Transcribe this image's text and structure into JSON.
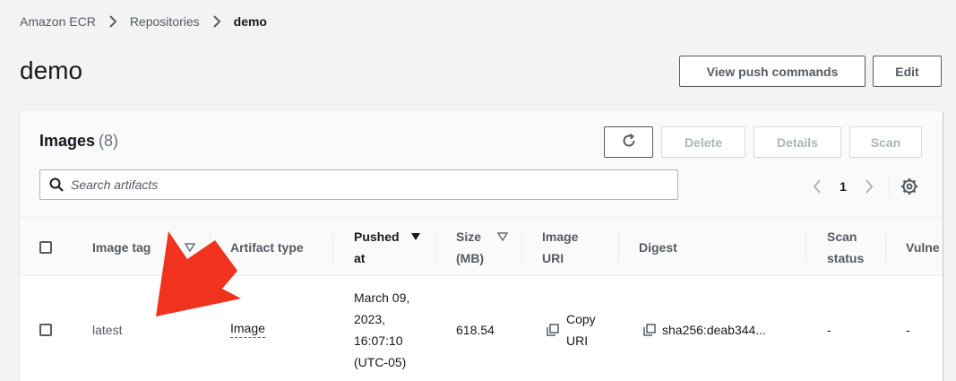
{
  "breadcrumb": {
    "root": "Amazon ECR",
    "section": "Repositories",
    "current": "demo"
  },
  "page": {
    "title": "demo",
    "view_push_label": "View push commands",
    "edit_label": "Edit"
  },
  "images_panel": {
    "title": "Images",
    "count": "(8)",
    "delete_label": "Delete",
    "details_label": "Details",
    "scan_label": "Scan",
    "search_placeholder": "Search artifacts",
    "page_number": "1"
  },
  "table": {
    "columns": {
      "image_tag": "Image tag",
      "artifact_type": "Artifact type",
      "pushed_at_1": "Pushed",
      "pushed_at_2": "at",
      "size_1": "Size",
      "size_2": "(MB)",
      "uri_1": "Image",
      "uri_2": "URI",
      "digest": "Digest",
      "scan_1": "Scan",
      "scan_2": "status",
      "vuln": "Vulne"
    },
    "rows": [
      {
        "tag": "latest",
        "artifact_type": "Image",
        "pushed_1": "March 09,",
        "pushed_2": "2023,",
        "pushed_3": "16:07:10",
        "pushed_4": "(UTC-05)",
        "size": "618.54",
        "copy_uri_1": "Copy",
        "copy_uri_2": "URI",
        "digest": "sha256:deab344...",
        "scan_status": "-",
        "vulnerabilities": "-"
      }
    ]
  },
  "colors": {
    "annotation_arrow": "#f0321f",
    "text_primary": "#16191f",
    "text_secondary": "#545b64"
  }
}
